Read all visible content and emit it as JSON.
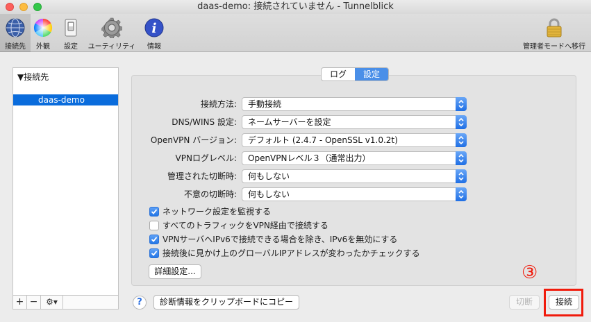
{
  "window": {
    "title": "daas-demo: 接続されていません - Tunnelblick"
  },
  "toolbar": {
    "items": [
      {
        "label": "接続先",
        "icon": "globe-icon"
      },
      {
        "label": "外観",
        "icon": "color-wheel-icon"
      },
      {
        "label": "設定",
        "icon": "switch-icon"
      },
      {
        "label": "ユーティリティ",
        "icon": "gear-icon"
      },
      {
        "label": "情報",
        "icon": "info-icon"
      }
    ],
    "admin_label": "管理者モードへ移行",
    "admin_icon": "lock-icon"
  },
  "sidebar": {
    "header": "▼接続先",
    "items": [
      {
        "label": "daas-demo"
      }
    ],
    "footer": {
      "add": "+",
      "remove": "−",
      "action": "⚙▾"
    }
  },
  "tabs": [
    {
      "label": "ログ"
    },
    {
      "label": "設定"
    }
  ],
  "settings": {
    "fields": [
      {
        "label": "接続方法:",
        "value": "手動接続"
      },
      {
        "label": "DNS/WINS 設定:",
        "value": "ネームサーバーを設定"
      },
      {
        "label": "OpenVPN バージョン:",
        "value": "デフォルト (2.4.7 - OpenSSL v1.0.2t)"
      },
      {
        "label": "VPNログレベル:",
        "value": "OpenVPNレベル３（通常出力）"
      },
      {
        "label": "管理された切断時:",
        "value": "何もしない"
      },
      {
        "label": "不意の切断時:",
        "value": "何もしない"
      }
    ],
    "checkboxes": [
      {
        "label": "ネットワーク設定を監視する",
        "checked": true
      },
      {
        "label": "すべてのトラフィックをVPN経由で接続する",
        "checked": false
      },
      {
        "label": "VPNサーバへIPv6で接続できる場合を除き、IPv6を無効にする",
        "checked": true
      },
      {
        "label": "接続後に見かけ上のグローバルIPアドレスが変わったかチェックする",
        "checked": true
      }
    ],
    "advanced_button": "詳細設定..."
  },
  "bottom": {
    "help": "?",
    "copy_diag": "診断情報をクリップボードにコピー",
    "disconnect": "切断",
    "connect": "接続"
  },
  "annotation": {
    "marker": "③",
    "color": "#f01b0c"
  }
}
